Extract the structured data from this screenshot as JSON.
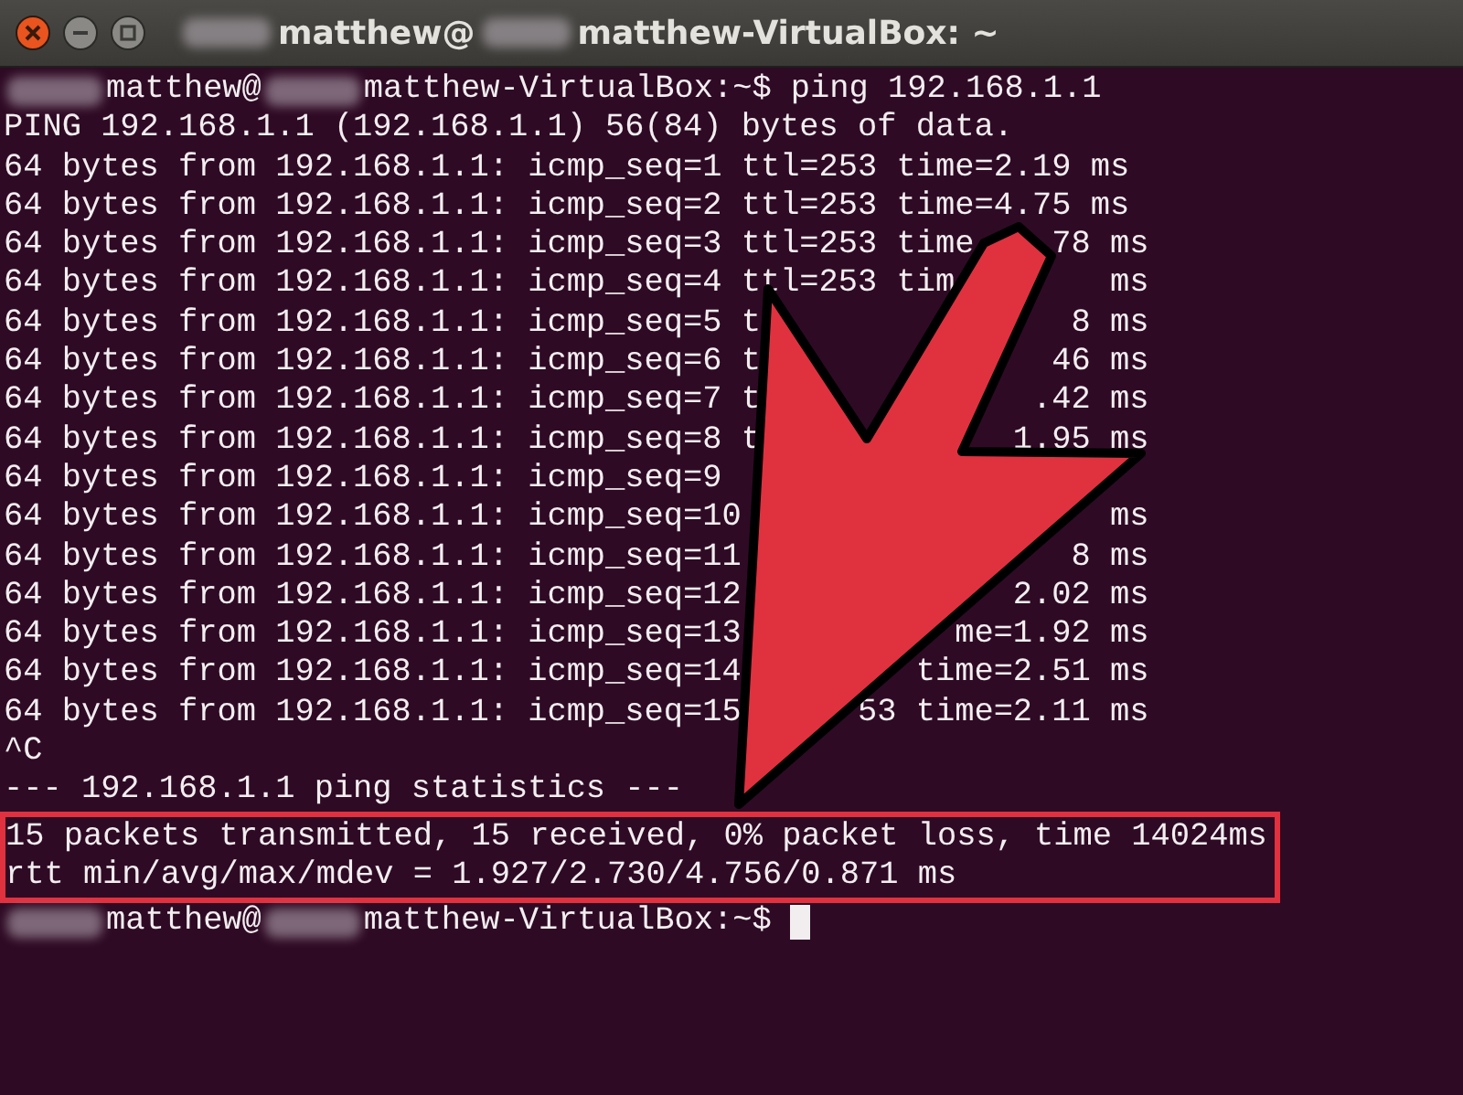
{
  "window": {
    "title_parts": [
      {
        "kind": "blur"
      },
      {
        "kind": "text",
        "text": "matthew@"
      },
      {
        "kind": "blur"
      },
      {
        "kind": "text",
        "text": "matthew-VirtualBox: ~"
      }
    ]
  },
  "terminal": {
    "lines": [
      {
        "kind": "prompt",
        "parts": [
          {
            "kind": "blur"
          },
          {
            "kind": "text",
            "text": "matthew@"
          },
          {
            "kind": "blur"
          },
          {
            "kind": "text",
            "text": "matthew-VirtualBox:~$ ping 192.168.1.1"
          }
        ]
      },
      {
        "kind": "text",
        "text": "PING 192.168.1.1 (192.168.1.1) 56(84) bytes of data."
      },
      {
        "kind": "text",
        "text": "64 bytes from 192.168.1.1: icmp_seq=1 ttl=253 time=2.19 ms"
      },
      {
        "kind": "text",
        "text": "64 bytes from 192.168.1.1: icmp_seq=2 ttl=253 time=4.75 ms"
      },
      {
        "kind": "split",
        "text": "64 bytes from 192.168.1.1: icmp_seq=3 ttl=253 time",
        "tail": "78 ms"
      },
      {
        "kind": "split",
        "text": "64 bytes from 192.168.1.1: icmp_seq=4 ttl=253 tim",
        "tail": "ms"
      },
      {
        "kind": "split",
        "text": "64 bytes from 192.168.1.1: icmp_seq=5 t",
        "tail": "8 ms"
      },
      {
        "kind": "split",
        "text": "64 bytes from 192.168.1.1: icmp_seq=6 t",
        "tail": "46 ms"
      },
      {
        "kind": "split",
        "text": "64 bytes from 192.168.1.1: icmp_seq=7 t",
        "tail": ".42 ms"
      },
      {
        "kind": "split",
        "text": "64 bytes from 192.168.1.1: icmp_seq=8 t",
        "tail": "1.95 ms"
      },
      {
        "kind": "text",
        "text": "64 bytes from 192.168.1.1: icmp_seq=9"
      },
      {
        "kind": "split",
        "text": "64 bytes from 192.168.1.1: icmp_seq=10",
        "tail": "ms"
      },
      {
        "kind": "split",
        "text": "64 bytes from 192.168.1.1: icmp_seq=11",
        "tail": "8 ms"
      },
      {
        "kind": "split",
        "text": "64 bytes from 192.168.1.1: icmp_seq=12",
        "tail": "2.02 ms"
      },
      {
        "kind": "split",
        "text": "64 bytes from 192.168.1.1: icmp_seq=13",
        "tail": "me=1.92 ms"
      },
      {
        "kind": "split",
        "text": "64 bytes from 192.168.1.1: icmp_seq=14",
        "tail": "time=2.51 ms"
      },
      {
        "kind": "split",
        "text": "64 bytes from 192.168.1.1: icmp_seq=15",
        "tail": "53 time=2.11 ms"
      },
      {
        "kind": "text",
        "text": "^C"
      },
      {
        "kind": "text",
        "text": "--- 192.168.1.1 ping statistics ---"
      }
    ],
    "highlight": {
      "lines": [
        "15 packets transmitted, 15 received, 0% packet loss, time 14024ms",
        "rtt min/avg/max/mdev = 1.927/2.730/4.756/0.871 ms"
      ]
    },
    "final_prompt": {
      "parts": [
        {
          "kind": "blur"
        },
        {
          "kind": "text",
          "text": "matthew@"
        },
        {
          "kind": "blur"
        },
        {
          "kind": "text",
          "text": "matthew-VirtualBox:~$ "
        }
      ],
      "cursor": true
    }
  }
}
